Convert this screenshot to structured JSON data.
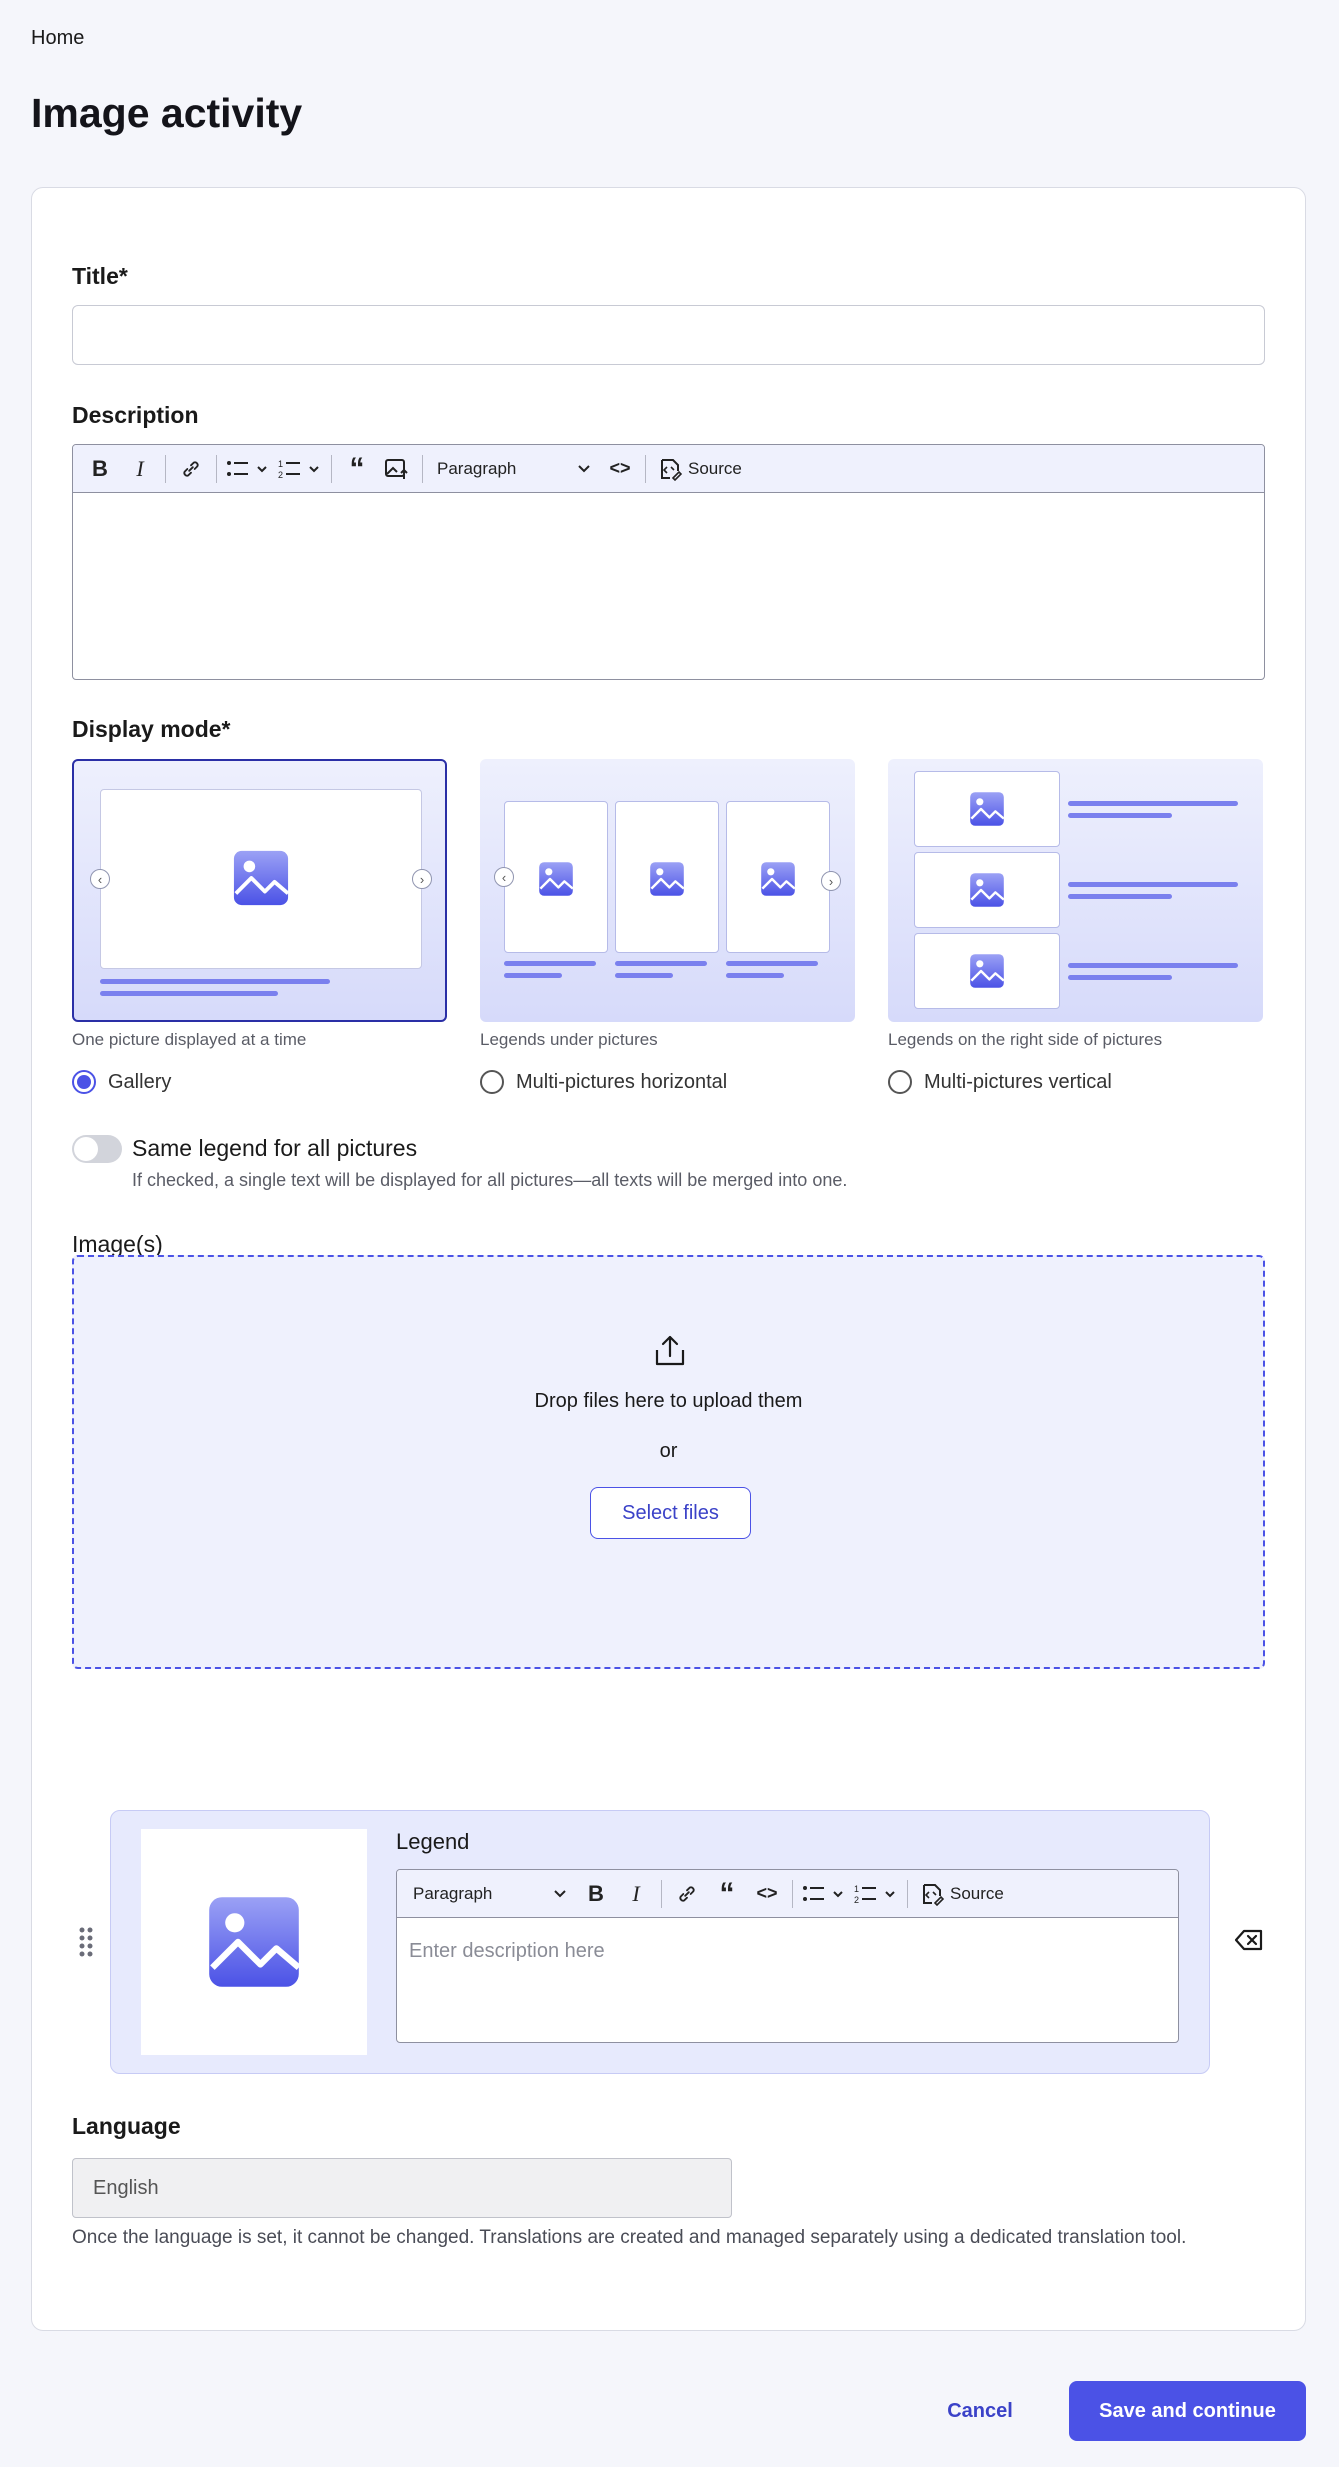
{
  "breadcrumb": {
    "home": "Home"
  },
  "page": {
    "title": "Image activity"
  },
  "form": {
    "title_label": "Title*",
    "title_value": "",
    "description_label": "Description",
    "description_toolbar": {
      "paragraph": "Paragraph",
      "source": "Source"
    },
    "display_mode_label": "Display mode*",
    "display_modes": [
      {
        "caption": "One picture displayed at a time",
        "label": "Gallery",
        "selected": true
      },
      {
        "caption": "Legends under pictures",
        "label": "Multi-pictures horizontal",
        "selected": false
      },
      {
        "caption": "Legends on the right side of pictures",
        "label": "Multi-pictures vertical",
        "selected": false
      }
    ],
    "same_legend": {
      "label": "Same legend for all pictures",
      "help": "If checked, a single text will be displayed for all pictures—all texts will be merged into one.",
      "checked": false
    },
    "images_label": "Image(s)",
    "dropzone": {
      "text": "Drop files here to upload them",
      "or": "or",
      "button": "Select files"
    },
    "legend": {
      "label": "Legend",
      "paragraph": "Paragraph",
      "source": "Source",
      "placeholder": "Enter description here"
    },
    "language_label": "Language",
    "language_value": "English",
    "language_help": "Once the language is set, it cannot be changed. Translations are created and managed separately using a dedicated translation tool."
  },
  "actions": {
    "cancel": "Cancel",
    "save": "Save and continue"
  },
  "colors": {
    "accent": "#4b52e6",
    "tile_bg": "#e7eafd"
  }
}
